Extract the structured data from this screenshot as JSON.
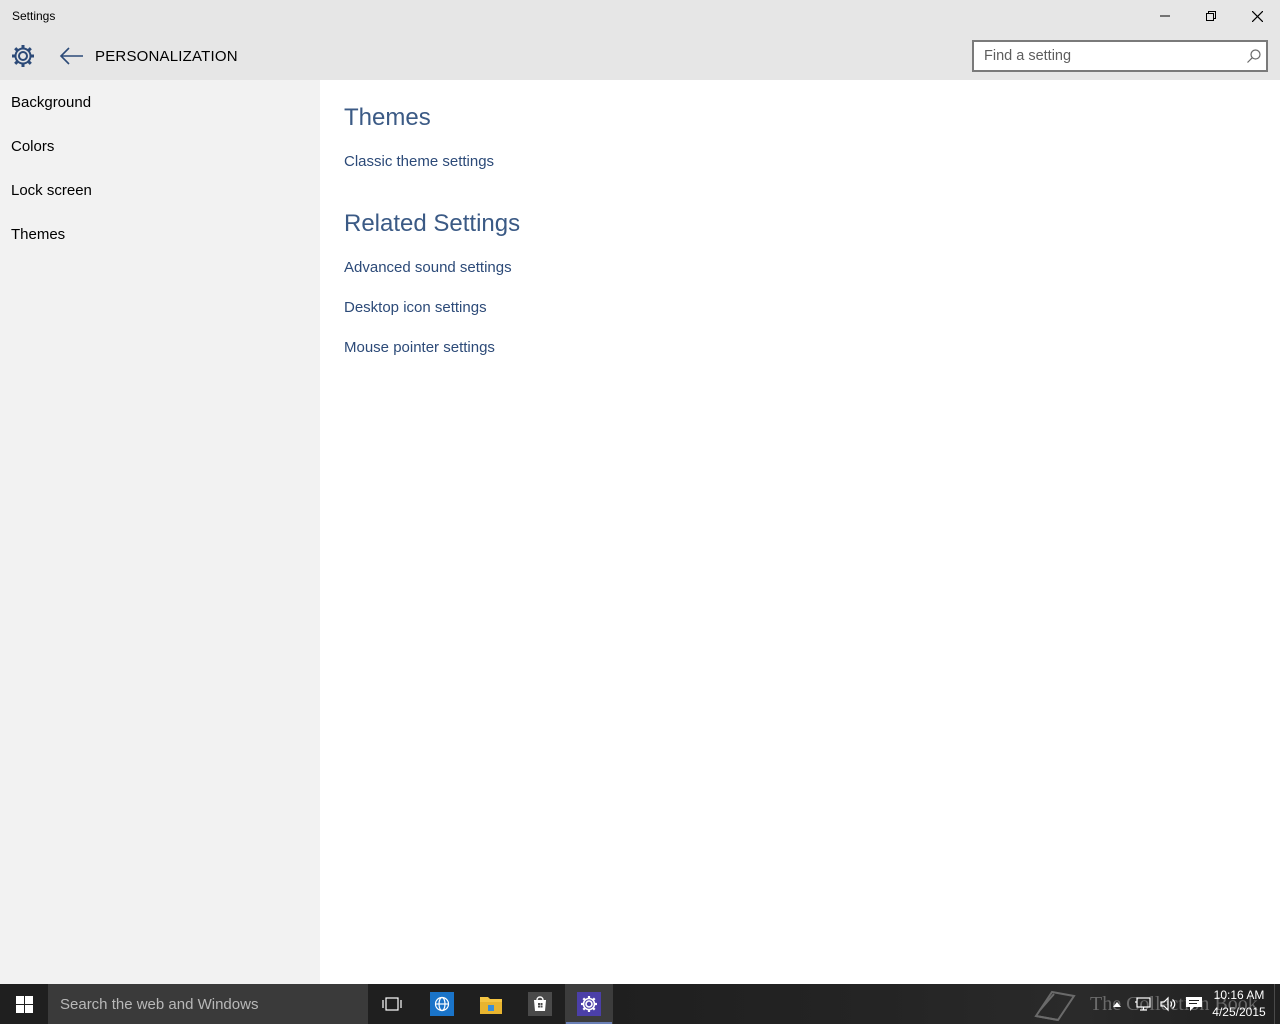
{
  "window": {
    "title": "Settings"
  },
  "header": {
    "page_title": "PERSONALIZATION",
    "search_placeholder": "Find a setting"
  },
  "sidebar": {
    "items": [
      {
        "label": "Background"
      },
      {
        "label": "Colors"
      },
      {
        "label": "Lock screen"
      },
      {
        "label": "Themes"
      }
    ]
  },
  "main": {
    "themes_heading": "Themes",
    "themes_links": [
      {
        "label": "Classic theme settings"
      }
    ],
    "related_heading": "Related Settings",
    "related_links": [
      {
        "label": "Advanced sound settings"
      },
      {
        "label": "Desktop icon settings"
      },
      {
        "label": "Mouse pointer settings"
      }
    ]
  },
  "taskbar": {
    "search_placeholder": "Search the web and Windows",
    "watermark": "The Collection Book",
    "time": "10:16 AM",
    "date": "4/25/2015",
    "icons": [
      "start-icon",
      "task-view-icon",
      "browser-icon",
      "file-explorer-icon",
      "store-icon",
      "settings-icon"
    ]
  },
  "colors": {
    "accent_link": "#2c4a78",
    "section_heading": "#3b5a85",
    "settings_taskbar_accent": "#4b3fa8"
  }
}
